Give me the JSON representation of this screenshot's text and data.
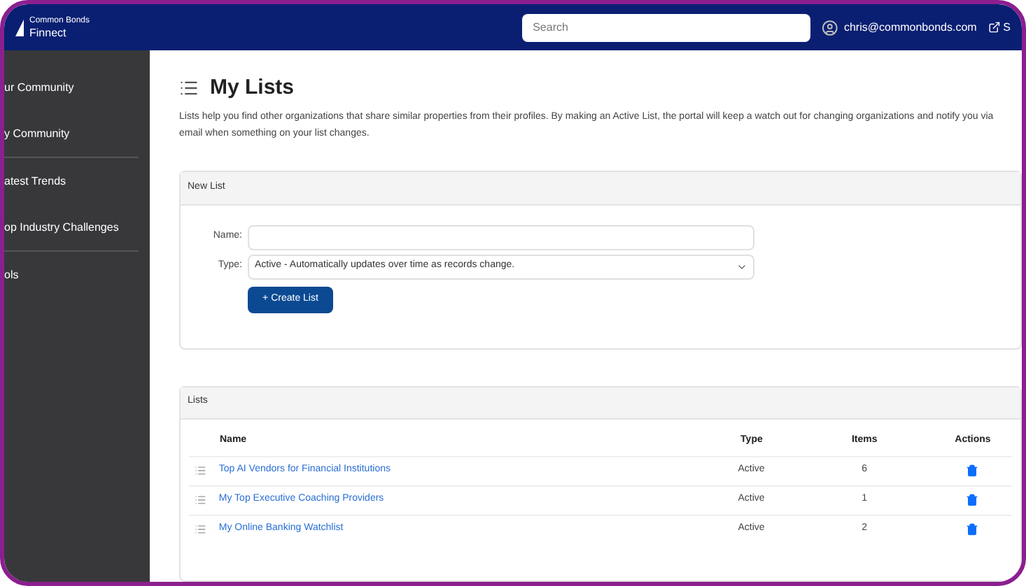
{
  "header": {
    "brand_top": "Common Bonds",
    "brand": "Finnect",
    "search": {
      "placeholder": "Search"
    },
    "user": "chris@commonbonds.com",
    "link": "S"
  },
  "sidebar": {
    "items": [
      {
        "label": "ur Community",
        "divider": false
      },
      {
        "label": "y Community",
        "divider": true
      },
      {
        "label": "atest Trends",
        "divider": false
      },
      {
        "label": "op Industry Challenges",
        "divider": true
      },
      {
        "label": "ols",
        "divider": false
      }
    ]
  },
  "page": {
    "title": "My Lists",
    "description": "Lists help you find other organizations that share similar properties from their profiles. By making an Active List, the portal will keep a watch out for changing organizations and notify you via email when something on your list changes."
  },
  "new_list": {
    "heading": "New List",
    "name_label": "Name:",
    "type_label": "Type:",
    "type_value": "Active - Automatically updates over time as records change.",
    "button": "+ Create List"
  },
  "lists": {
    "heading": "Lists",
    "columns": [
      "Name",
      "Type",
      "Items",
      "Actions"
    ],
    "rows": [
      {
        "name": "Top AI Vendors for Financial Institutions",
        "type": "Active",
        "items": "6"
      },
      {
        "name": "My Top Executive Coaching Providers",
        "type": "Active",
        "items": "1"
      },
      {
        "name": "My Online Banking Watchlist",
        "type": "Active",
        "items": "2"
      }
    ]
  }
}
